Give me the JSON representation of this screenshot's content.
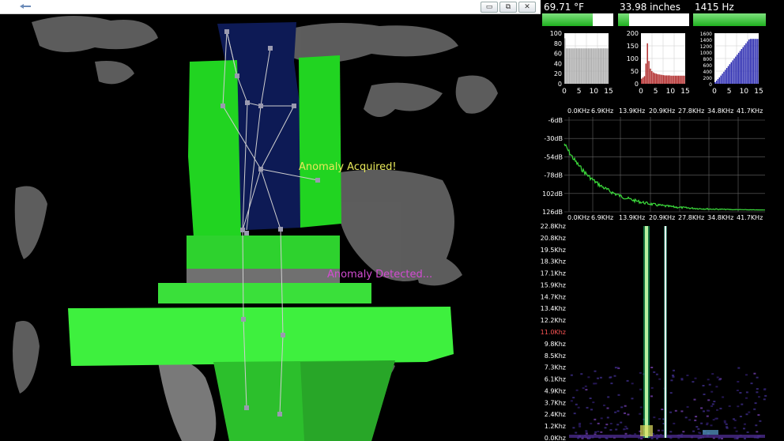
{
  "titlebar": {
    "icon": "app-icon",
    "buttons": [
      {
        "name": "minimize-button",
        "glyph": "▭"
      },
      {
        "name": "restore-button",
        "glyph": "⧉"
      },
      {
        "name": "close-button",
        "glyph": "✕"
      }
    ]
  },
  "overlays": {
    "acquired": "Anomaly Acquired!",
    "detected": "Anomaly Detected..."
  },
  "sensors": {
    "temperature": {
      "text": "69.71 °F",
      "level": 0.71,
      "color": "#2fbf2f"
    },
    "distance": {
      "text": "33.98 inches",
      "level": 0.16,
      "color": "#2fbf2f"
    },
    "frequency": {
      "text": "1415 Hz",
      "level": 1.0,
      "color": "#2fbf2f"
    }
  },
  "histograms": [
    {
      "name": "temperature-histogram",
      "yticks": [
        "100",
        "80",
        "60",
        "40",
        "20",
        "0"
      ],
      "ymax": 100,
      "xticks": [
        "0",
        "5",
        "10",
        "15"
      ],
      "color": "#aaaaaa",
      "values": [
        90,
        70,
        70,
        70,
        70,
        70,
        70,
        70,
        70,
        70,
        70,
        70,
        70,
        70,
        70,
        70,
        70,
        70,
        70,
        70,
        70,
        70,
        70,
        70,
        70,
        70,
        70,
        70,
        70,
        70
      ]
    },
    {
      "name": "distance-histogram",
      "yticks": [
        "200",
        "150",
        "100",
        "50",
        "0"
      ],
      "ymax": 200,
      "xticks": [
        "0",
        "5",
        "10",
        "15"
      ],
      "color": "#b02a2a",
      "values": [
        20,
        25,
        30,
        80,
        160,
        90,
        60,
        50,
        45,
        42,
        40,
        38,
        37,
        36,
        35,
        34,
        33,
        33,
        33,
        33,
        32,
        32,
        32,
        32,
        32,
        32,
        32,
        32,
        32,
        32
      ]
    },
    {
      "name": "frequency-histogram",
      "yticks": [
        "1600",
        "1400",
        "1200",
        "1000",
        "800",
        "600",
        "400",
        "200",
        "0"
      ],
      "ymax": 1600,
      "xticks": [
        "0",
        "5",
        "10",
        "15"
      ],
      "color": "#2a2ab0",
      "values": [
        50,
        100,
        150,
        200,
        260,
        320,
        380,
        440,
        500,
        560,
        620,
        680,
        740,
        800,
        860,
        920,
        980,
        1040,
        1100,
        1160,
        1220,
        1280,
        1340,
        1400,
        1420,
        1420,
        1420,
        1420,
        1420,
        1420
      ]
    }
  ],
  "spectrum": {
    "xticks": [
      "0.0KHz",
      "6.9KHz",
      "13.9KHz",
      "20.9KHz",
      "27.8KHz",
      "34.8KHz",
      "41.7KHz"
    ],
    "yticks": [
      "-6dB",
      "-30dB",
      "-54dB",
      "-78dB",
      "102dB",
      "126dB"
    ],
    "line_color": "#3cdc3c"
  },
  "spectrogram": {
    "yticks": [
      "22.8Khz",
      "20.8Khz",
      "19.5Khz",
      "18.3Khz",
      "17.1Khz",
      "15.9Khz",
      "14.7Khz",
      "13.4Khz",
      "12.2Khz",
      "11.0Khz",
      "9.8Khz",
      "8.5Khz",
      "7.3Khz",
      "6.1Khz",
      "4.9Khz",
      "3.7Khz",
      "2.4Khz",
      "1.2Khz",
      "0.0Khz"
    ],
    "highlight_tick": "11.0Khz",
    "highlight_color": "#ff5555"
  }
}
